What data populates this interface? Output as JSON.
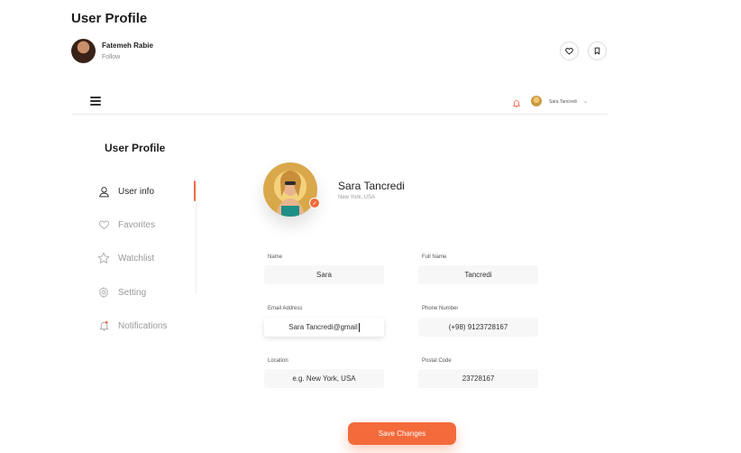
{
  "shot": {
    "title": "User Profile",
    "author_name": "Fatemeh Rabie",
    "author_follow": "Follow"
  },
  "topbar": {
    "user_name": "Sara Tancredi"
  },
  "sidebar": {
    "title": "User Profile",
    "items": [
      {
        "label": "User info",
        "icon": "user-icon",
        "active": true
      },
      {
        "label": "Favorites",
        "icon": "heart-icon",
        "active": false
      },
      {
        "label": "Watchlist",
        "icon": "star-icon",
        "active": false
      },
      {
        "label": "Setting",
        "icon": "gear-icon",
        "active": false
      },
      {
        "label": "Notifications",
        "icon": "bell-icon",
        "active": false
      }
    ]
  },
  "profile": {
    "name": "Sara Tancredi",
    "location": "New York, USA"
  },
  "form": {
    "name": {
      "label": "Name",
      "value": "Sara"
    },
    "full_name": {
      "label": "Full Name",
      "value": "Tancredi"
    },
    "email": {
      "label": "Email Address",
      "value": "Sara Tancredi@gmail"
    },
    "phone": {
      "label": "Phone Number",
      "value": "(+98) 9123728167"
    },
    "location": {
      "label": "Location",
      "value": "e.g. New York, USA"
    },
    "postal": {
      "label": "Postal Code",
      "value": "23728167"
    },
    "save_label": "Save Changes"
  },
  "colors": {
    "accent": "#f36a3b",
    "active_indicator": "#f26a4b"
  }
}
